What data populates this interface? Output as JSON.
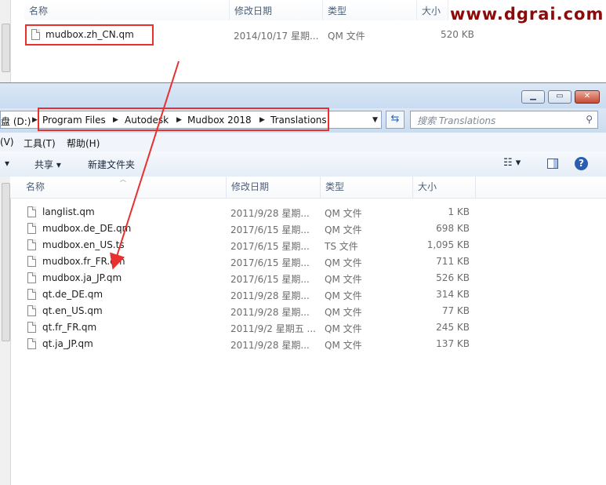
{
  "top_pane": {
    "columns": [
      "名称",
      "修改日期",
      "类型",
      "大小"
    ],
    "file": {
      "name": "mudbox.zh_CN.qm",
      "date": "2014/10/17 星期...",
      "type": "QM 文件",
      "size": "520 KB"
    },
    "watermark": "www.dgrai.com"
  },
  "window": {
    "address": {
      "drive": "盘 (D:)",
      "crumbs": [
        "Program Files",
        "Autodesk",
        "Mudbox 2018",
        "Translations"
      ]
    },
    "search_placeholder": "搜索 Translations",
    "menu": [
      "(V)",
      "工具(T)",
      "帮助(H)"
    ],
    "toolbar": {
      "share": "共享 ▾",
      "new_folder": "新建文件夹"
    },
    "columns": [
      "名称",
      "修改日期",
      "类型",
      "大小"
    ],
    "files": [
      {
        "name": "langlist.qm",
        "date": "2011/9/28 星期...",
        "type": "QM 文件",
        "size": "1 KB"
      },
      {
        "name": "mudbox.de_DE.qm",
        "date": "2017/6/15 星期...",
        "type": "QM 文件",
        "size": "698 KB"
      },
      {
        "name": "mudbox.en_US.ts",
        "date": "2017/6/15 星期...",
        "type": "TS 文件",
        "size": "1,095 KB"
      },
      {
        "name": "mudbox.fr_FR.qm",
        "date": "2017/6/15 星期...",
        "type": "QM 文件",
        "size": "711 KB"
      },
      {
        "name": "mudbox.ja_JP.qm",
        "date": "2017/6/15 星期...",
        "type": "QM 文件",
        "size": "526 KB"
      },
      {
        "name": "qt.de_DE.qm",
        "date": "2011/9/28 星期...",
        "type": "QM 文件",
        "size": "314 KB"
      },
      {
        "name": "qt.en_US.qm",
        "date": "2011/9/28 星期...",
        "type": "QM 文件",
        "size": "77 KB"
      },
      {
        "name": "qt.fr_FR.qm",
        "date": "2011/9/2 星期五 ...",
        "type": "QM 文件",
        "size": "245 KB"
      },
      {
        "name": "qt.ja_JP.qm",
        "date": "2011/9/28 星期...",
        "type": "QM 文件",
        "size": "137 KB"
      }
    ]
  },
  "colors": {
    "highlight": "#e8302c",
    "watermark": "#8b0a0a",
    "header_text": "#4c607a"
  },
  "icons": [
    "file-icon",
    "refresh-icon",
    "search-icon",
    "view-options-icon",
    "preview-pane-icon",
    "help-icon",
    "minimize-icon",
    "maximize-icon",
    "close-icon"
  ]
}
